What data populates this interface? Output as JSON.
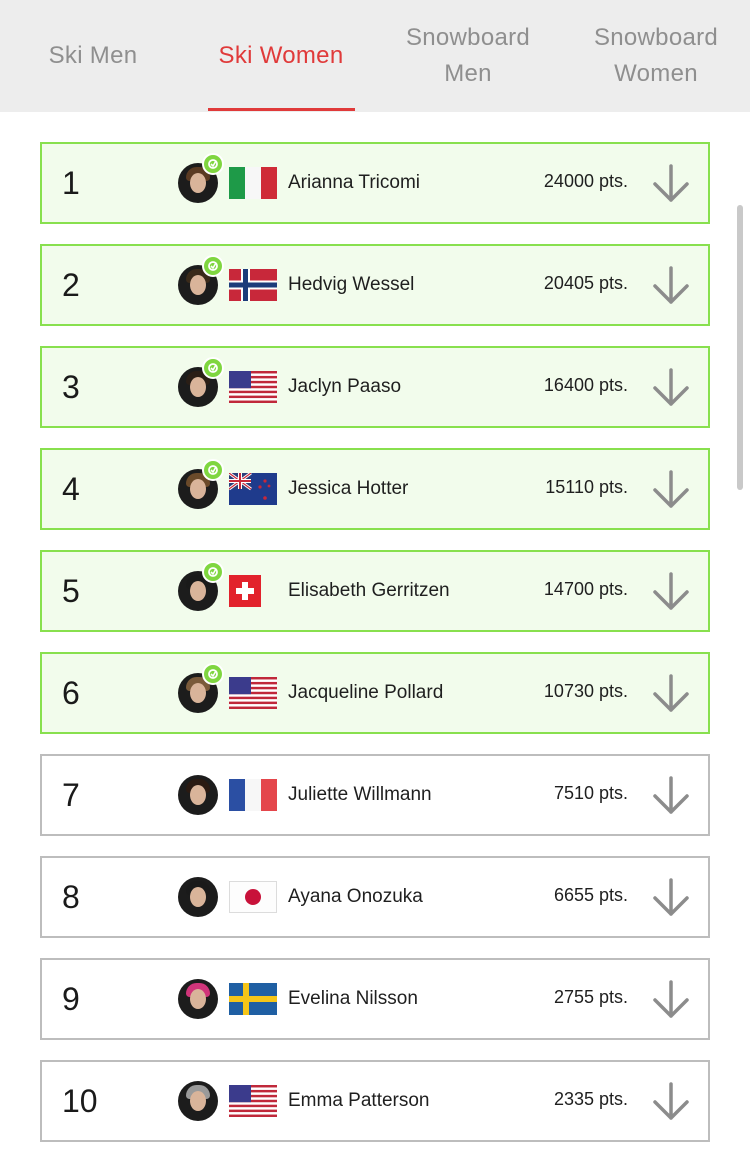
{
  "tabs": [
    {
      "label_line1": "Ski Men",
      "label_line2": "",
      "active": false
    },
    {
      "label_line1": "Ski Women",
      "label_line2": "",
      "active": true
    },
    {
      "label_line1": "Snowboard",
      "label_line2": "Men",
      "active": false
    },
    {
      "label_line1": "Snowboard",
      "label_line2": "Women",
      "active": false
    }
  ],
  "colors": {
    "accent": "#e03a3a",
    "qualified_border": "#88e04e",
    "qualified_bg": "#f2fcec",
    "default_border": "#bdbdbd",
    "tab_bg": "#ededed"
  },
  "rankings": [
    {
      "rank": "1",
      "name": "Arianna Tricomi",
      "points": "24000 pts.",
      "country_flag": "italy-flag",
      "qualified": true
    },
    {
      "rank": "2",
      "name": "Hedvig Wessel",
      "points": "20405 pts.",
      "country_flag": "norway-flag",
      "qualified": true
    },
    {
      "rank": "3",
      "name": "Jaclyn Paaso",
      "points": "16400 pts.",
      "country_flag": "usa-flag",
      "qualified": true
    },
    {
      "rank": "4",
      "name": "Jessica Hotter",
      "points": "15110 pts.",
      "country_flag": "new-zealand-flag",
      "qualified": true
    },
    {
      "rank": "5",
      "name": "Elisabeth Gerritzen",
      "points": "14700 pts.",
      "country_flag": "switzerland-flag",
      "qualified": true
    },
    {
      "rank": "6",
      "name": "Jacqueline Pollard",
      "points": "10730 pts.",
      "country_flag": "usa-flag",
      "qualified": true
    },
    {
      "rank": "7",
      "name": "Juliette Willmann",
      "points": "7510 pts.",
      "country_flag": "france-flag",
      "qualified": false
    },
    {
      "rank": "8",
      "name": "Ayana Onozuka",
      "points": "6655 pts.",
      "country_flag": "japan-flag",
      "qualified": false
    },
    {
      "rank": "9",
      "name": "Evelina Nilsson",
      "points": "2755 pts.",
      "country_flag": "sweden-flag",
      "qualified": false
    },
    {
      "rank": "10",
      "name": "Emma Patterson",
      "points": "2335 pts.",
      "country_flag": "usa-flag",
      "qualified": false
    }
  ],
  "icons": {
    "qualified_badge": "qualified-check-icon",
    "expand_arrow": "arrow-down-icon"
  }
}
